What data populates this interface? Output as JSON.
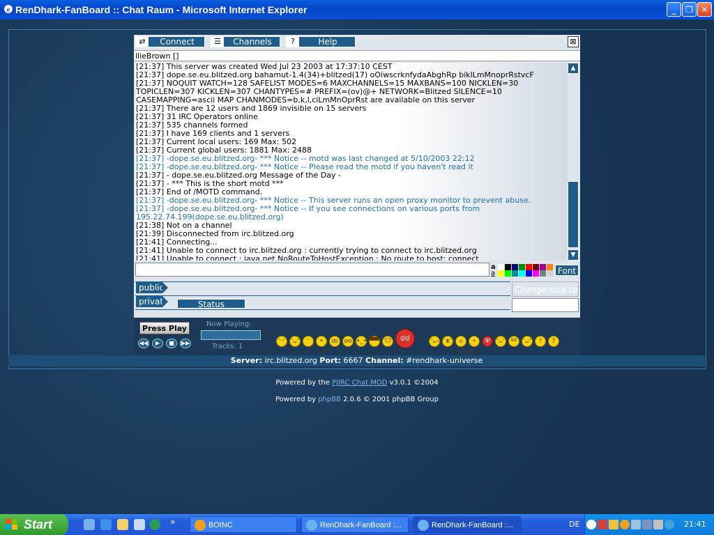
{
  "window": {
    "title": "RenDhark-FanBoard :: Chat Raum - Microsoft Internet Explorer",
    "minimize_icon": "minimize-icon",
    "maximize_icon": "maximize-icon",
    "close_icon": "close-icon"
  },
  "chat": {
    "toolbar": {
      "connect": "Connect",
      "channels": "Channels",
      "help": "Help",
      "close_glyph": "⊠",
      "help_glyph": "?"
    },
    "nick_line": "llieBrown []",
    "log": [
      {
        "t": "[21:37] This server was created Wed Jul 23 2003 at 17:37:10 CEST",
        "k": "n"
      },
      {
        "t": "[21:37] dope.se.eu.blitzed.org bahamut-1.4(34)+blitzed(17) oOiwscrknfydaAbghRp biklLmMnoprRstvcF",
        "k": "n"
      },
      {
        "t": "[21:37] NOQUIT WATCH=128 SAFELIST MODES=6 MAXCHANNELS=15 MAXBANS=100 NICKLEN=30",
        "k": "n"
      },
      {
        "t": " TOPICLEN=307 KICKLEN=307 CHANTYPES=# PREFIX=(ov)@+ NETWORK=Blitzed SILENCE=10",
        "k": "n"
      },
      {
        "t": " CASEMAPPING=ascii MAP CHANMODES=b,k,l,ciLmMnOprRst are available on this server",
        "k": "n"
      },
      {
        "t": "[21:37] There are 12 users and 1869 invisible on 15 servers",
        "k": "n"
      },
      {
        "t": "[21:37] 31 IRC Operators online",
        "k": "n"
      },
      {
        "t": "[21:37] 535 channels formed",
        "k": "n"
      },
      {
        "t": "[21:37] I have 169 clients and 1 servers",
        "k": "n"
      },
      {
        "t": "[21:37] Current local users: 169 Max: 502",
        "k": "n"
      },
      {
        "t": "[21:37] Current global users: 1881 Max: 2488",
        "k": "n"
      },
      {
        "t": "[21:37] -dope.se.eu.blitzed.org- *** Notice -- motd was last changed at 5/10/2003 22:12",
        "k": "notice"
      },
      {
        "t": "[21:37] -dope.se.eu.blitzed.org- *** Notice -- Please read the motd if you haven't read it",
        "k": "notice"
      },
      {
        "t": "[21:37] - dope.se.eu.blitzed.org Message of the Day -",
        "k": "n"
      },
      {
        "t": "[21:37] - *** This is the short motd ***",
        "k": "n"
      },
      {
        "t": "[21:37] End of /MOTD command.",
        "k": "n"
      },
      {
        "t": "[21:37] -dope.se.eu.blitzed.org- *** Notice -- This server runs an open proxy monitor to prevent abuse.",
        "k": "notice"
      },
      {
        "t": "[21:37] -dope.se.eu.blitzed.org- *** Notice -- If you see connections on various ports from",
        "k": "notice"
      },
      {
        "t": " 195.22.74.199(dope.se.eu.blitzed.org)",
        "k": "notice"
      },
      {
        "t": "[21:38] Not on a channel",
        "k": "n"
      },
      {
        "t": "[21:39] Disconnected from irc.blitzed.org",
        "k": "n"
      },
      {
        "t": "[21:41] Connecting...",
        "k": "n"
      },
      {
        "t": "[21:41] Unable to connect to irc.blitzed.org : currently trying to connect to irc.blitzed.org",
        "k": "n"
      },
      {
        "t": "[21:41] Unable to connect : java.net.NoRouteToHostException : No route to host: connect",
        "k": "n"
      }
    ],
    "format_bold": "a",
    "format_underline": "a",
    "palette": [
      "#ffffff",
      "#000000",
      "#00007f",
      "#009300",
      "#ff0000",
      "#7f0000",
      "#9c009c",
      "#fc7f00",
      "#ffff00",
      "#00fc00",
      "#009393",
      "#00ffff",
      "#0000fc",
      "#ff00ff",
      "#7f7f7f",
      "#d2d2d2"
    ],
    "font_button": "Font",
    "tab_public": "public",
    "tab_private": "private",
    "status_tab": "Status",
    "change_nick_placeholder": "Change nick to",
    "player": {
      "press_play": "Press Play",
      "now_playing": "Now Playing:",
      "tracks": "Tracks: 1",
      "controls": [
        "◀◀",
        "▶",
        "■",
        "▶▶"
      ]
    },
    "smileys": [
      {
        "name": "grin-smiley-icon",
        "glyph": "ᵔᵕᵔ",
        "kind": "y"
      },
      {
        "name": "smile-smiley-icon",
        "glyph": "ᵔᴗᵔ",
        "kind": "y"
      },
      {
        "name": "sad-smiley-icon",
        "glyph": "ᵔ︵ᵔ",
        "kind": "y"
      },
      {
        "name": "frown-smiley-icon",
        "glyph": "•︵•",
        "kind": "y"
      },
      {
        "name": "confused-smiley-icon",
        "glyph": "ꝏ",
        "kind": "y"
      },
      {
        "name": "eek-smiley-icon",
        "glyph": "oo",
        "kind": "y"
      },
      {
        "name": "neutral-smiley-icon",
        "glyph": "•_•",
        "kind": "y"
      },
      {
        "name": "cool-smiley-icon",
        "glyph": "▀▀",
        "kind": "y"
      },
      {
        "name": "laugh-smiley-icon",
        "glyph": "ᵔᗜᵔ",
        "kind": "y"
      },
      {
        "name": "angry-smiley-icon",
        "glyph": "ಠಠ",
        "kind": "red"
      },
      {
        "name": "wink-smiley-icon",
        "glyph": "ᵔᴗ-",
        "kind": "y"
      },
      {
        "name": "razz-smiley-icon",
        "glyph": "ᵔᴥᵔ",
        "kind": "y"
      },
      {
        "name": "mad-smiley-icon",
        "glyph": "ಠ︵ಠ",
        "kind": "y"
      },
      {
        "name": "sick-smiley-icon",
        "glyph": "•︵•",
        "kind": "y"
      },
      {
        "name": "devil-smiley-icon",
        "glyph": "Ψ",
        "kind": "red"
      },
      {
        "name": "evil-smiley-icon",
        "glyph": "ᵔᴗᵔ",
        "kind": "y"
      },
      {
        "name": "roll-smiley-icon",
        "glyph": "ºº",
        "kind": "y"
      },
      {
        "name": "smile2-smiley-icon",
        "glyph": "ᵔᴗᵔ",
        "kind": "y"
      },
      {
        "name": "exclaim-icon",
        "glyph": "!",
        "kind": "y"
      },
      {
        "name": "question-icon",
        "glyph": "?",
        "kind": "y"
      }
    ]
  },
  "infobar": {
    "server_label": "Server:",
    "server": "irc.blitzed.org",
    "port_label": "Port:",
    "port": "6667",
    "channel_label": "Channel:",
    "channel": "#rendhark-universe"
  },
  "credits": {
    "line1_pre": "Powered by the ",
    "line1_link": "PJIRC Chat MOD",
    "line1_post": " v3.0.1 ©2004",
    "line2_pre": "Powered by ",
    "line2_link": "phpBB",
    "line2_post": " 2.0.6 © 2001 phpBB Group"
  },
  "taskbar": {
    "start": "Start",
    "tasks": [
      {
        "label": "BOINC",
        "icon": "boinc-icon",
        "active": false
      },
      {
        "label": "RenDhark-FanBoard :...",
        "icon": "ie-icon",
        "active": false
      },
      {
        "label": "RenDhark-FanBoard :...",
        "icon": "ie-icon",
        "active": true
      }
    ],
    "quicklaunch_expand": "»",
    "language": "DE",
    "clock": "21:41"
  }
}
